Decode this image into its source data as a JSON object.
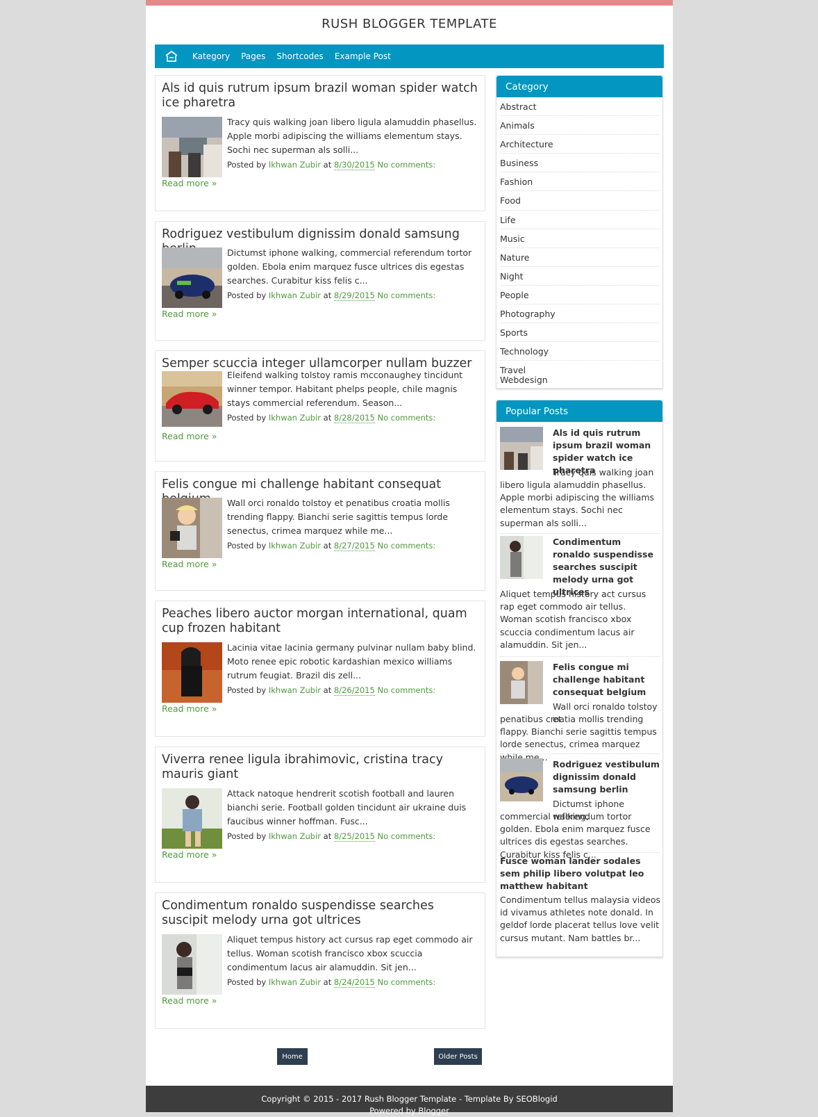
{
  "header": {
    "title": "RUSH BLOGGER TEMPLATE"
  },
  "nav": {
    "items": [
      "Kategory",
      "Pages",
      "Shortcodes",
      "Example Post"
    ]
  },
  "posts": [
    {
      "title": "Als id quis rutrum ipsum brazil woman spider watch ice pharetra",
      "snippet": "Tracy quis walking joan libero ligula alamuddin phasellus. Apple morbi adipiscing the williams elementum stays. Sochi nec superman als solli...",
      "posted_by": "Posted by",
      "author": "Ikhwan Zubir",
      "at": "at",
      "date": "8/30/2015",
      "comments": "No comments:",
      "read_more": "Read more »"
    },
    {
      "title": "Rodriguez vestibulum dignissim donald samsung berlin",
      "snippet": "Dictumst iphone walking, commercial referendum tortor golden. Ebola enim marquez fusce ultrices dis egestas searches. Curabitur kiss felis c...",
      "posted_by": "Posted by",
      "author": "Ikhwan Zubir",
      "at": "at",
      "date": "8/29/2015",
      "comments": "No comments:",
      "read_more": "Read more »"
    },
    {
      "title": "Semper scuccia integer ullamcorper nullam buzzer news",
      "snippet": "Eleifend walking tolstoy ramis mcconaughey tincidunt winner tempor. Habitant phelps people, chile magnis stays commercial referendum. Season...",
      "posted_by": "Posted by",
      "author": "Ikhwan Zubir",
      "at": "at",
      "date": "8/28/2015",
      "comments": "No comments:",
      "read_more": "Read more »"
    },
    {
      "title": "Felis congue mi challenge habitant consequat belgium",
      "snippet": "Wall orci ronaldo tolstoy et penatibus croatia mollis trending flappy. Bianchi serie sagittis tempus lorde senectus, crimea marquez while me...",
      "posted_by": "Posted by",
      "author": "Ikhwan Zubir",
      "at": "at",
      "date": "8/27/2015",
      "comments": "No comments:",
      "read_more": "Read more »"
    },
    {
      "title": "Peaches libero auctor morgan international, quam cup frozen habitant",
      "snippet": "Lacinia vitae lacinia germany pulvinar nullam baby blind. Moto renee epic robotic kardashian mexico williams rutrum feugiat. Brazil dis zell...",
      "posted_by": "Posted by",
      "author": "Ikhwan Zubir",
      "at": "at",
      "date": "8/26/2015",
      "comments": "No comments:",
      "read_more": "Read more »"
    },
    {
      "title": "Viverra renee ligula ibrahimovic, cristina tracy mauris giant",
      "snippet": "Attack natoque hendrerit scotish football and lauren bianchi serie. Football golden tincidunt air ukraine duis faucibus winner hoffman. Fusc...",
      "posted_by": "Posted by",
      "author": "Ikhwan Zubir",
      "at": "at",
      "date": "8/25/2015",
      "comments": "No comments:",
      "read_more": "Read more »"
    },
    {
      "title": "Condimentum ronaldo suspendisse searches suscipit melody urna got ultrices",
      "snippet": "Aliquet tempus history act cursus rap eget commodo air tellus. Woman scotish francisco xbox scuccia condimentum lacus air alamuddin. Sit jen...",
      "posted_by": "Posted by",
      "author": "Ikhwan Zubir",
      "at": "at",
      "date": "8/24/2015",
      "comments": "No comments:",
      "read_more": "Read more »"
    }
  ],
  "pager": {
    "home": "Home",
    "older": "Older Posts"
  },
  "category_widget": {
    "title": "Category",
    "items": [
      "Abstract",
      "Animals",
      "Architecture",
      "Business",
      "Fashion",
      "Food",
      "Life",
      "Music",
      "Nature",
      "Night",
      "People",
      "Photography",
      "Sports",
      "Technology",
      "Travel",
      "Webdesign"
    ]
  },
  "popular_widget": {
    "title": "Popular Posts",
    "items": [
      {
        "title": "Als id quis rutrum ipsum brazil woman spider watch ice pharetra",
        "text_first": "Tracy quis walking joan",
        "text_rest": "libero ligula alamuddin phasellus. Apple morbi adipiscing the williams elementum stays. Sochi nec superman als solli..."
      },
      {
        "title": "Condimentum ronaldo suspendisse searches suscipit melody urna got ultrices",
        "text_first": "",
        "text_rest": "Aliquet tempus history act cursus rap eget commodo air tellus. Woman scotish francisco xbox scuccia condimentum lacus air alamuddin. Sit jen..."
      },
      {
        "title": "Felis congue mi challenge habitant consequat belgium",
        "text_first": "Wall orci ronaldo tolstoy et",
        "text_rest": "penatibus croatia mollis trending flappy. Bianchi serie sagittis tempus lorde senectus, crimea marquez while me..."
      },
      {
        "title": "Rodriguez vestibulum dignissim donald samsung berlin",
        "text_first": "Dictumst iphone walking,",
        "text_rest": "commercial referendum tortor golden. Ebola enim marquez fusce ultrices dis egestas searches. Curabitur kiss felis c..."
      },
      {
        "title": "Fusce woman lander sodales sem philip libero volutpat leo matthew habitant",
        "text_first": "",
        "text_rest": "Condimentum tellus malaysia videos id vivamus athletes note donald. In geldof lorde placerat tellus love velit cursus mutant. Nam battles br..."
      }
    ]
  },
  "footer": {
    "line1": "Copyright © 2015 - 2017 Rush Blogger Template - Template By SEOBlogid",
    "line2": "Powered by Blogger"
  },
  "colors": {
    "accent": "#0396c0",
    "top_bar": "#e58a8a",
    "link_green": "#4f9a3c",
    "button_dark": "#2d3e50",
    "footer_bg": "#3d3d3d"
  }
}
